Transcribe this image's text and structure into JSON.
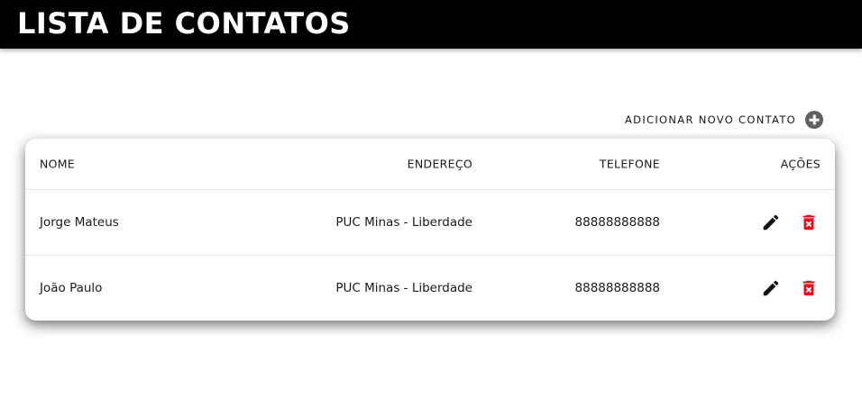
{
  "header": {
    "title": "LISTA DE CONTATOS"
  },
  "add_contact": {
    "label": "ADICIONAR NOVO CONTATO",
    "icon": "plus-circle-icon"
  },
  "table": {
    "columns": [
      "NOME",
      "ENDEREÇO",
      "TELEFONE",
      "AÇÕES"
    ],
    "rows": [
      {
        "nome": "Jorge Mateus",
        "endereco": "PUC Minas - Liberdade",
        "telefone": "88888888888"
      },
      {
        "nome": "João Paulo",
        "endereco": "PUC Minas - Liberdade",
        "telefone": "88888888888"
      }
    ],
    "action_icons": {
      "edit": "pencil-icon",
      "delete": "trash-icon"
    }
  },
  "colors": {
    "topbar": "#000000",
    "delete": "#e3101b",
    "add_icon": "#5f5f5f"
  }
}
